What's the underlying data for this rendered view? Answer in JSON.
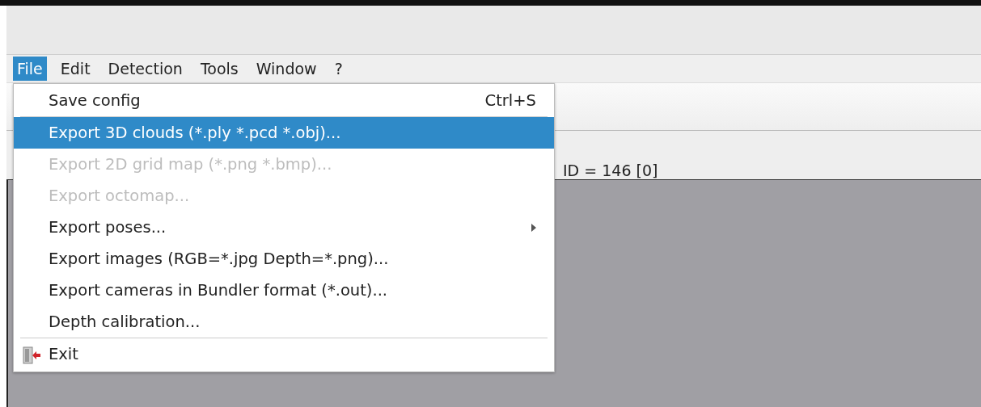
{
  "menubar": [
    {
      "label": "File",
      "selected": true
    },
    {
      "label": "Edit",
      "selected": false
    },
    {
      "label": "Detection",
      "selected": false
    },
    {
      "label": "Tools",
      "selected": false
    },
    {
      "label": "Window",
      "selected": false
    },
    {
      "label": "?",
      "selected": false
    }
  ],
  "status": {
    "text": "ID = 146 [0]"
  },
  "file_menu": [
    {
      "kind": "item",
      "label": "Save config",
      "shortcut": "Ctrl+S",
      "selected": false,
      "disabled": false
    },
    {
      "kind": "separator"
    },
    {
      "kind": "item",
      "label": "Export 3D clouds (*.ply *.pcd *.obj)...",
      "selected": true,
      "disabled": false
    },
    {
      "kind": "item",
      "label": "Export 2D grid map (*.png *.bmp)...",
      "selected": false,
      "disabled": true
    },
    {
      "kind": "item",
      "label": "Export octomap...",
      "selected": false,
      "disabled": true
    },
    {
      "kind": "submenu",
      "label": "Export poses...",
      "selected": false,
      "disabled": false
    },
    {
      "kind": "item",
      "label": "Export images (RGB=*.jpg Depth=*.png)...",
      "selected": false,
      "disabled": false
    },
    {
      "kind": "item",
      "label": "Export cameras in Bundler format (*.out)...",
      "selected": false,
      "disabled": false
    },
    {
      "kind": "item",
      "label": "Depth calibration...",
      "selected": false,
      "disabled": false
    },
    {
      "kind": "separator"
    },
    {
      "kind": "exit",
      "label": "Exit",
      "selected": false,
      "disabled": false
    }
  ]
}
